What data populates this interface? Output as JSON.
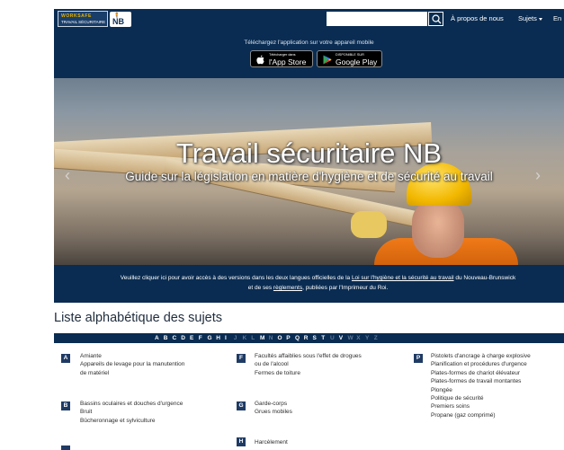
{
  "header": {
    "logo_line1": "WORKSAFE",
    "logo_line2": "TRAVAIL SÉCURITAIRE",
    "logo_badge": "NB",
    "search_placeholder": "",
    "nav_about": "À propos de nous",
    "nav_subjects": "Sujets",
    "nav_lang": "En"
  },
  "app_strip": {
    "text": "Téléchargez l'application sur votre appareil mobile",
    "apple_small": "Télécharger dans",
    "apple_big": "l'App Store",
    "google_small": "DISPONIBLE SUR",
    "google_big": "Google Play"
  },
  "hero": {
    "title": "Travail sécuritaire NB",
    "subtitle": "Guide sur la législation en matière d'hygiène et de sécurité au travail"
  },
  "notice": {
    "line1_a": "Veuillez cliquer ici pour avoir accès à des versions dans les deux langues officielles de la ",
    "line1_link": "Loi sur l'hygiène et la sécurité au travail",
    "line1_b": " du Nouveau-Brunswick",
    "line2_a": "et de ses ",
    "line2_link": "règlements",
    "line2_b": ", publiées par l'Imprimeur du Roi."
  },
  "az": {
    "heading": "Liste alphabétique des sujets",
    "letters": [
      {
        "l": "A",
        "active": true
      },
      {
        "l": "B",
        "active": true
      },
      {
        "l": "C",
        "active": true
      },
      {
        "l": "D",
        "active": true
      },
      {
        "l": "E",
        "active": true
      },
      {
        "l": "F",
        "active": true
      },
      {
        "l": "G",
        "active": true
      },
      {
        "l": "H",
        "active": true
      },
      {
        "l": "I",
        "active": true
      },
      {
        "l": "J",
        "active": false
      },
      {
        "l": "K",
        "active": false
      },
      {
        "l": "L",
        "active": false
      },
      {
        "l": "M",
        "active": true
      },
      {
        "l": "N",
        "active": false
      },
      {
        "l": "O",
        "active": true
      },
      {
        "l": "P",
        "active": true
      },
      {
        "l": "Q",
        "active": true
      },
      {
        "l": "R",
        "active": true
      },
      {
        "l": "S",
        "active": true
      },
      {
        "l": "T",
        "active": true
      },
      {
        "l": "U",
        "active": false
      },
      {
        "l": "V",
        "active": true
      },
      {
        "l": "W",
        "active": false
      },
      {
        "l": "X",
        "active": false
      },
      {
        "l": "Y",
        "active": false
      },
      {
        "l": "Z",
        "active": false
      }
    ]
  },
  "columns": {
    "col1": {
      "groups": [
        {
          "letter": "A",
          "items": [
            "Amiante",
            "Appareils de levage pour la manutention",
            "de matériel"
          ]
        },
        {
          "letter": "B",
          "items": [
            "Bassins oculaires et douches d'urgence",
            "Bruit",
            "Bûcheronnage et sylviculture"
          ]
        }
      ]
    },
    "col2": {
      "groups": [
        {
          "letter": "F",
          "items": [
            "Facultés affaiblies sous l'effet de drogues",
            "ou de l'alcool",
            "Fermes de toiture"
          ]
        },
        {
          "letter": "G",
          "items": [
            "Garde-corps",
            "Grues mobiles"
          ]
        },
        {
          "letter": "H",
          "items": [
            "Harcèlement"
          ]
        }
      ]
    },
    "col3": {
      "groups": [
        {
          "letter": "P",
          "items": [
            "Pistolets d'ancrage à charge explosive",
            "Planification et procédures d'urgence",
            "Plates-formes de chariot élévateur",
            "Plates-formes de travail montantes",
            "Plongée",
            "Politique de sécurité",
            "Premiers soins",
            "Propane (gaz comprimé)"
          ]
        }
      ]
    }
  },
  "colors": {
    "navy": "#0a2c52",
    "badge": "#1f3b64",
    "letter_active": "#ffffff",
    "letter_inactive": "#5f7895"
  }
}
